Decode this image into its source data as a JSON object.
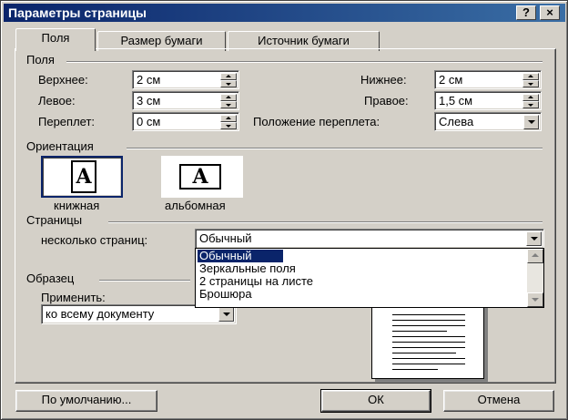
{
  "window": {
    "title": "Параметры страницы",
    "help_button": "?",
    "close_button": "×"
  },
  "tabs": [
    {
      "label": "Поля",
      "active": true
    },
    {
      "label": "Размер бумаги",
      "active": false
    },
    {
      "label": "Источник бумаги",
      "active": false
    }
  ],
  "margins": {
    "group_label": "Поля",
    "top_label": "Верхнее:",
    "top_value": "2 см",
    "bottom_label": "Нижнее:",
    "bottom_value": "2 см",
    "left_label": "Левое:",
    "left_value": "3 см",
    "right_label": "Правое:",
    "right_value": "1,5 см",
    "gutter_label": "Переплет:",
    "gutter_value": "0 см",
    "gutter_pos_label": "Положение переплета:",
    "gutter_pos_value": "Слева"
  },
  "orientation": {
    "group_label": "Ориентация",
    "portrait_label": "книжная",
    "landscape_label": "альбомная",
    "icon_letter": "A",
    "selected": "portrait"
  },
  "pages": {
    "group_label": "Страницы",
    "multiple_label": "несколько страниц:",
    "multiple_value": "Обычный",
    "options": [
      "Обычный",
      "Зеркальные поля",
      "2 страницы на листе",
      "Брошюра"
    ],
    "selected_option": "Обычный"
  },
  "sample": {
    "group_label": "Образец",
    "apply_label": "Применить:",
    "apply_value": "ко всему документу"
  },
  "buttons": {
    "default": "По умолчанию...",
    "ok": "ОК",
    "cancel": "Отмена"
  },
  "colors": {
    "title_bar": "#0a246a",
    "selection": "#0a246a",
    "face": "#d4d0c8"
  }
}
